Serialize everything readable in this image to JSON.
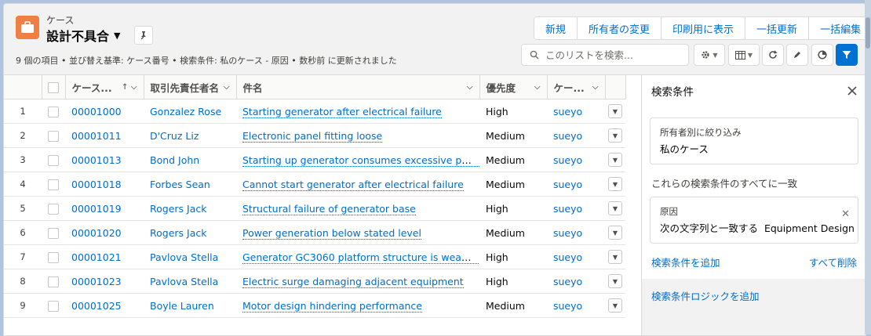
{
  "header": {
    "object_label": "ケース",
    "list_title": "設計不具合",
    "meta": "9 個の項目 • 並び替え基準: ケース番号 • 検索条件: 私のケース - 原因 • 数秒前 に更新されました"
  },
  "actions": [
    "新規",
    "所有者の変更",
    "印刷用に表示",
    "一括更新",
    "一括編集"
  ],
  "search": {
    "placeholder": "このリストを検索..."
  },
  "icons": {
    "object": "briefcase-icon",
    "pin": "pin-icon",
    "search": "search-icon",
    "settings": "gear-icon",
    "display": "table-icon",
    "refresh": "refresh-icon",
    "edit": "pencil-icon",
    "chart": "pie-chart-icon",
    "filter": "filter-icon"
  },
  "colors": {
    "accent": "#0070d2",
    "object": "#ef7f45",
    "link": "#006dcc"
  },
  "table": {
    "columns": [
      "ケース...",
      "取引先責任者名",
      "件名",
      "優先度",
      "ケー..."
    ],
    "rows": [
      {
        "n": "1",
        "case": "00001000",
        "contact": "Gonzalez Rose",
        "subject": "Starting generator after electrical failure",
        "priority": "High",
        "owner": "sueyo"
      },
      {
        "n": "2",
        "case": "00001011",
        "contact": "D'Cruz Liz",
        "subject": "Electronic panel fitting loose",
        "priority": "Medium",
        "owner": "sueyo"
      },
      {
        "n": "3",
        "case": "00001013",
        "contact": "Bond John",
        "subject": "Starting up generator consumes excessive pow...",
        "priority": "Medium",
        "owner": "sueyo"
      },
      {
        "n": "4",
        "case": "00001018",
        "contact": "Forbes Sean",
        "subject": "Cannot start generator after electrical failure",
        "priority": "Medium",
        "owner": "sueyo"
      },
      {
        "n": "5",
        "case": "00001019",
        "contact": "Rogers Jack",
        "subject": "Structural failure of generator base",
        "priority": "High",
        "owner": "sueyo"
      },
      {
        "n": "6",
        "case": "00001020",
        "contact": "Rogers Jack",
        "subject": "Power generation below stated level",
        "priority": "Medium",
        "owner": "sueyo"
      },
      {
        "n": "7",
        "case": "00001021",
        "contact": "Pavlova Stella",
        "subject": "Generator GC3060 platform structure is weake...",
        "priority": "High",
        "owner": "sueyo"
      },
      {
        "n": "8",
        "case": "00001023",
        "contact": "Pavlova Stella",
        "subject": "Electric surge damaging adjacent equipment",
        "priority": "High",
        "owner": "sueyo"
      },
      {
        "n": "9",
        "case": "00001025",
        "contact": "Boyle Lauren",
        "subject": "Motor design hindering performance",
        "priority": "Medium",
        "owner": "sueyo"
      }
    ]
  },
  "filter_panel": {
    "title": "検索条件",
    "owner_filter_label": "所有者別に絞り込み",
    "owner_filter_value": "私のケース",
    "match_all": "これらの検索条件のすべてに一致",
    "condition_field": "原因",
    "condition_value": "次の文字列と一致する  Equipment Design",
    "add_filter": "検索条件を追加",
    "remove_all": "すべて削除",
    "add_logic": "検索条件ロジックを追加"
  }
}
